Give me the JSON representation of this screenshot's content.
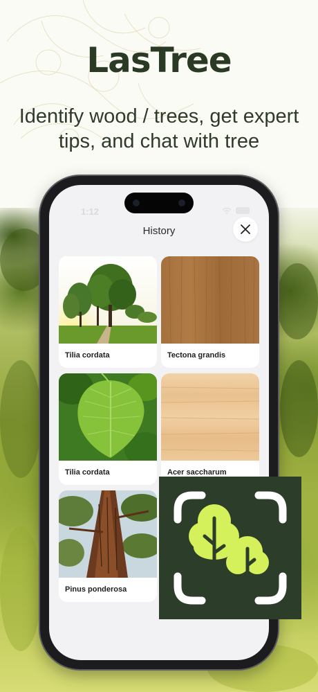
{
  "promo": {
    "title": "LasTree",
    "tagline": "Identify wood / trees, get expert tips, and chat with tree"
  },
  "status_bar": {
    "time": "1:12"
  },
  "history": {
    "title": "History",
    "items": [
      {
        "label": "Tilia cordata",
        "image": "tree-landscape"
      },
      {
        "label": "Tectona grandis",
        "image": "dark-wood-grain"
      },
      {
        "label": "Tilia cordata",
        "image": "green-leaf"
      },
      {
        "label": "Acer saccharum",
        "image": "light-wood-grain"
      },
      {
        "label": "Pinus ponderosa",
        "image": "pine-trunk"
      }
    ]
  },
  "colors": {
    "brand_dark_green": "#2c3e2a",
    "icon_leaf_green": "#d4f05a",
    "screen_background": "#f2f2f4"
  }
}
